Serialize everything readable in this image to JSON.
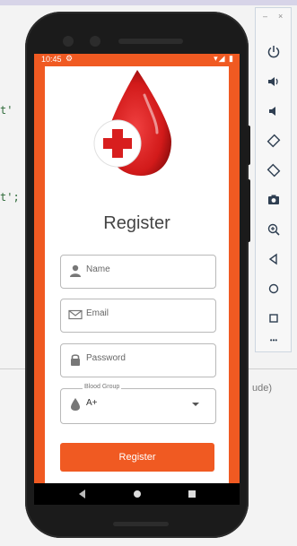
{
  "ide": {
    "code_line_1": "t'",
    "code_line_2": "t';",
    "hint_text": "ude)"
  },
  "status_bar": {
    "time": "10:45",
    "settings_glyph": "⚙",
    "signal_battery": "▾◢ ▮"
  },
  "app": {
    "title": "Register",
    "fields": {
      "name_placeholder": "Name",
      "email_placeholder": "Email",
      "password_placeholder": "Password"
    },
    "blood_group": {
      "label": "Blood Group",
      "selected": "A+"
    },
    "register_button": "Register"
  },
  "emulator_toolbar": {
    "minimize": "–",
    "close": "×",
    "more": "•••"
  },
  "colors": {
    "accent": "#f05a22",
    "logo_red": "#d81e1e"
  }
}
